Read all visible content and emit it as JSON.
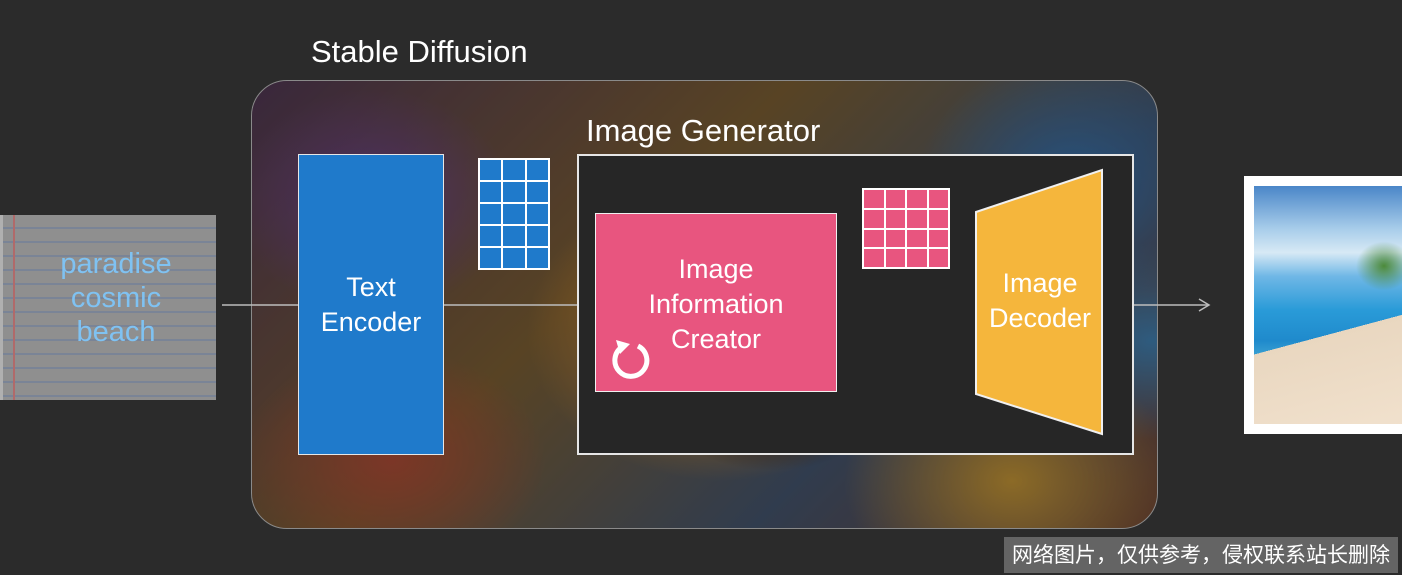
{
  "input": {
    "prompt_lines": [
      "paradise",
      "cosmic",
      "beach"
    ]
  },
  "stable_diffusion": {
    "title": "Stable Diffusion"
  },
  "text_encoder": {
    "label_lines": [
      "Text",
      "Encoder"
    ]
  },
  "image_generator": {
    "title": "Image Generator"
  },
  "image_information_creator": {
    "label_lines": [
      "Image",
      "Information",
      "Creator"
    ]
  },
  "image_decoder": {
    "label_lines": [
      "Image",
      "Decoder"
    ]
  },
  "colors": {
    "text_encoder": "#1f7acb",
    "information_creator": "#e8557f",
    "decoder": "#f5b63c",
    "prompt_text": "#7fc2f2"
  },
  "icons": {
    "loop": "refresh-icon"
  },
  "watermark": "网络图片，仅供参考，侵权联系站长删除"
}
